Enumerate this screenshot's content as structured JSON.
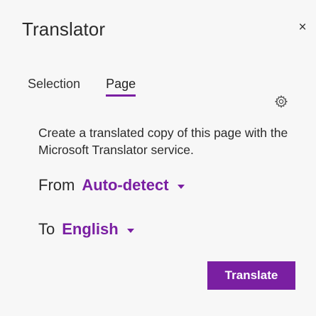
{
  "header": {
    "title": "Translator",
    "close_glyph": "×"
  },
  "tabs": [
    {
      "label": "Selection",
      "active": false
    },
    {
      "label": "Page",
      "active": true
    }
  ],
  "settings": {
    "icon": "gear-icon"
  },
  "description": "Create a translated copy of this page with the Microsoft Translator service.",
  "from": {
    "label": "From",
    "value": "Auto-detect"
  },
  "to": {
    "label": "To",
    "value": "English"
  },
  "actions": {
    "translate_label": "Translate"
  },
  "colors": {
    "accent": "#7a1fa2",
    "background": "#f7f7f7",
    "text": "#2b2b2b"
  }
}
